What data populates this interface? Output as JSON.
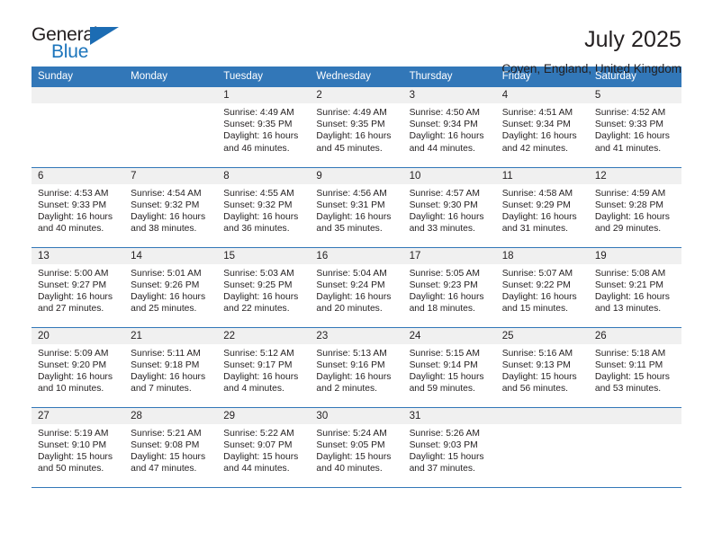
{
  "brand": {
    "word_general": "General",
    "word_blue": "Blue",
    "triangle_color": "#1c6cb3",
    "blue_color": "#1c75bc"
  },
  "header": {
    "title": "July 2025",
    "subtitle": "Coven, England, United Kingdom"
  },
  "theme": {
    "header_bg": "#3277b8",
    "daynum_bg": "#f0f0f0",
    "grid_line": "#3277b8",
    "text": "#231f20"
  },
  "weekdays": [
    "Sunday",
    "Monday",
    "Tuesday",
    "Wednesday",
    "Thursday",
    "Friday",
    "Saturday"
  ],
  "labels": {
    "sunrise_prefix": "Sunrise: ",
    "sunset_prefix": "Sunset: ",
    "daylight_prefix": "Daylight: "
  },
  "weeks": [
    [
      {
        "day": "",
        "sunrise": "",
        "sunset": "",
        "daylight_line1": "",
        "daylight_line2": ""
      },
      {
        "day": "",
        "sunrise": "",
        "sunset": "",
        "daylight_line1": "",
        "daylight_line2": ""
      },
      {
        "day": "1",
        "sunrise": "Sunrise: 4:49 AM",
        "sunset": "Sunset: 9:35 PM",
        "daylight_line1": "Daylight: 16 hours",
        "daylight_line2": "and 46 minutes."
      },
      {
        "day": "2",
        "sunrise": "Sunrise: 4:49 AM",
        "sunset": "Sunset: 9:35 PM",
        "daylight_line1": "Daylight: 16 hours",
        "daylight_line2": "and 45 minutes."
      },
      {
        "day": "3",
        "sunrise": "Sunrise: 4:50 AM",
        "sunset": "Sunset: 9:34 PM",
        "daylight_line1": "Daylight: 16 hours",
        "daylight_line2": "and 44 minutes."
      },
      {
        "day": "4",
        "sunrise": "Sunrise: 4:51 AM",
        "sunset": "Sunset: 9:34 PM",
        "daylight_line1": "Daylight: 16 hours",
        "daylight_line2": "and 42 minutes."
      },
      {
        "day": "5",
        "sunrise": "Sunrise: 4:52 AM",
        "sunset": "Sunset: 9:33 PM",
        "daylight_line1": "Daylight: 16 hours",
        "daylight_line2": "and 41 minutes."
      }
    ],
    [
      {
        "day": "6",
        "sunrise": "Sunrise: 4:53 AM",
        "sunset": "Sunset: 9:33 PM",
        "daylight_line1": "Daylight: 16 hours",
        "daylight_line2": "and 40 minutes."
      },
      {
        "day": "7",
        "sunrise": "Sunrise: 4:54 AM",
        "sunset": "Sunset: 9:32 PM",
        "daylight_line1": "Daylight: 16 hours",
        "daylight_line2": "and 38 minutes."
      },
      {
        "day": "8",
        "sunrise": "Sunrise: 4:55 AM",
        "sunset": "Sunset: 9:32 PM",
        "daylight_line1": "Daylight: 16 hours",
        "daylight_line2": "and 36 minutes."
      },
      {
        "day": "9",
        "sunrise": "Sunrise: 4:56 AM",
        "sunset": "Sunset: 9:31 PM",
        "daylight_line1": "Daylight: 16 hours",
        "daylight_line2": "and 35 minutes."
      },
      {
        "day": "10",
        "sunrise": "Sunrise: 4:57 AM",
        "sunset": "Sunset: 9:30 PM",
        "daylight_line1": "Daylight: 16 hours",
        "daylight_line2": "and 33 minutes."
      },
      {
        "day": "11",
        "sunrise": "Sunrise: 4:58 AM",
        "sunset": "Sunset: 9:29 PM",
        "daylight_line1": "Daylight: 16 hours",
        "daylight_line2": "and 31 minutes."
      },
      {
        "day": "12",
        "sunrise": "Sunrise: 4:59 AM",
        "sunset": "Sunset: 9:28 PM",
        "daylight_line1": "Daylight: 16 hours",
        "daylight_line2": "and 29 minutes."
      }
    ],
    [
      {
        "day": "13",
        "sunrise": "Sunrise: 5:00 AM",
        "sunset": "Sunset: 9:27 PM",
        "daylight_line1": "Daylight: 16 hours",
        "daylight_line2": "and 27 minutes."
      },
      {
        "day": "14",
        "sunrise": "Sunrise: 5:01 AM",
        "sunset": "Sunset: 9:26 PM",
        "daylight_line1": "Daylight: 16 hours",
        "daylight_line2": "and 25 minutes."
      },
      {
        "day": "15",
        "sunrise": "Sunrise: 5:03 AM",
        "sunset": "Sunset: 9:25 PM",
        "daylight_line1": "Daylight: 16 hours",
        "daylight_line2": "and 22 minutes."
      },
      {
        "day": "16",
        "sunrise": "Sunrise: 5:04 AM",
        "sunset": "Sunset: 9:24 PM",
        "daylight_line1": "Daylight: 16 hours",
        "daylight_line2": "and 20 minutes."
      },
      {
        "day": "17",
        "sunrise": "Sunrise: 5:05 AM",
        "sunset": "Sunset: 9:23 PM",
        "daylight_line1": "Daylight: 16 hours",
        "daylight_line2": "and 18 minutes."
      },
      {
        "day": "18",
        "sunrise": "Sunrise: 5:07 AM",
        "sunset": "Sunset: 9:22 PM",
        "daylight_line1": "Daylight: 16 hours",
        "daylight_line2": "and 15 minutes."
      },
      {
        "day": "19",
        "sunrise": "Sunrise: 5:08 AM",
        "sunset": "Sunset: 9:21 PM",
        "daylight_line1": "Daylight: 16 hours",
        "daylight_line2": "and 13 minutes."
      }
    ],
    [
      {
        "day": "20",
        "sunrise": "Sunrise: 5:09 AM",
        "sunset": "Sunset: 9:20 PM",
        "daylight_line1": "Daylight: 16 hours",
        "daylight_line2": "and 10 minutes."
      },
      {
        "day": "21",
        "sunrise": "Sunrise: 5:11 AM",
        "sunset": "Sunset: 9:18 PM",
        "daylight_line1": "Daylight: 16 hours",
        "daylight_line2": "and 7 minutes."
      },
      {
        "day": "22",
        "sunrise": "Sunrise: 5:12 AM",
        "sunset": "Sunset: 9:17 PM",
        "daylight_line1": "Daylight: 16 hours",
        "daylight_line2": "and 4 minutes."
      },
      {
        "day": "23",
        "sunrise": "Sunrise: 5:13 AM",
        "sunset": "Sunset: 9:16 PM",
        "daylight_line1": "Daylight: 16 hours",
        "daylight_line2": "and 2 minutes."
      },
      {
        "day": "24",
        "sunrise": "Sunrise: 5:15 AM",
        "sunset": "Sunset: 9:14 PM",
        "daylight_line1": "Daylight: 15 hours",
        "daylight_line2": "and 59 minutes."
      },
      {
        "day": "25",
        "sunrise": "Sunrise: 5:16 AM",
        "sunset": "Sunset: 9:13 PM",
        "daylight_line1": "Daylight: 15 hours",
        "daylight_line2": "and 56 minutes."
      },
      {
        "day": "26",
        "sunrise": "Sunrise: 5:18 AM",
        "sunset": "Sunset: 9:11 PM",
        "daylight_line1": "Daylight: 15 hours",
        "daylight_line2": "and 53 minutes."
      }
    ],
    [
      {
        "day": "27",
        "sunrise": "Sunrise: 5:19 AM",
        "sunset": "Sunset: 9:10 PM",
        "daylight_line1": "Daylight: 15 hours",
        "daylight_line2": "and 50 minutes."
      },
      {
        "day": "28",
        "sunrise": "Sunrise: 5:21 AM",
        "sunset": "Sunset: 9:08 PM",
        "daylight_line1": "Daylight: 15 hours",
        "daylight_line2": "and 47 minutes."
      },
      {
        "day": "29",
        "sunrise": "Sunrise: 5:22 AM",
        "sunset": "Sunset: 9:07 PM",
        "daylight_line1": "Daylight: 15 hours",
        "daylight_line2": "and 44 minutes."
      },
      {
        "day": "30",
        "sunrise": "Sunrise: 5:24 AM",
        "sunset": "Sunset: 9:05 PM",
        "daylight_line1": "Daylight: 15 hours",
        "daylight_line2": "and 40 minutes."
      },
      {
        "day": "31",
        "sunrise": "Sunrise: 5:26 AM",
        "sunset": "Sunset: 9:03 PM",
        "daylight_line1": "Daylight: 15 hours",
        "daylight_line2": "and 37 minutes."
      },
      {
        "day": "",
        "sunrise": "",
        "sunset": "",
        "daylight_line1": "",
        "daylight_line2": ""
      },
      {
        "day": "",
        "sunrise": "",
        "sunset": "",
        "daylight_line1": "",
        "daylight_line2": ""
      }
    ]
  ]
}
